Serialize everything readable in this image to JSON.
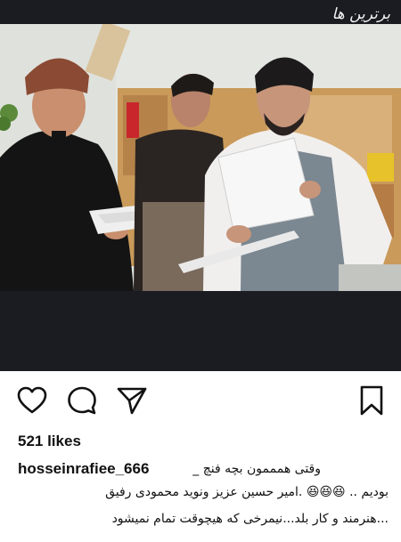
{
  "watermark": {
    "text": "برترین ها"
  },
  "post": {
    "likes": "521 likes",
    "username": "hosseinrafiee_666",
    "caption": {
      "line1": "وقتی همممون بچه فنچ _",
      "line2": "بودیم .. 😆😆😆 .امیر حسین عزیز ونوید محمودی رفیق",
      "line3": "...هنرمند و کار بلد...نیمرخی که هیچوقت تمام نمیشود"
    }
  },
  "icons": {
    "like": "heart-icon",
    "comment": "speech-bubble-icon",
    "share": "paper-plane-icon",
    "save": "bookmark-icon"
  },
  "colors": {
    "band": "#1b1c22",
    "text": "#111111",
    "background": "#ffffff"
  }
}
